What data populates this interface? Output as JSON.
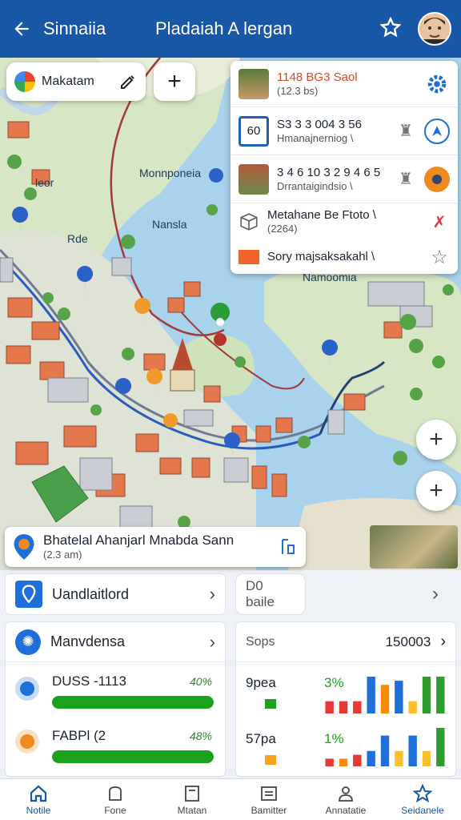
{
  "header": {
    "app_title": "Sinnaiia",
    "page_title": "Pladaiah A lergan"
  },
  "search": {
    "value": "Makatam"
  },
  "info_panel": {
    "rows": [
      {
        "title": "1148 BG3 Saol",
        "subtitle": "(12.3 bs)"
      },
      {
        "title": "S3 3 3 004 3 56",
        "subtitle": "Hmanajnerniog \\",
        "badge": "60"
      },
      {
        "title": "3 4 6 10 3 2 9 4 6 5",
        "subtitle": "Drrantaigindsio \\"
      },
      {
        "title": "Metahane Be Ftoto \\",
        "subtitle": "(2264)"
      },
      {
        "title": "Sory majsaksakahl \\",
        "subtitle": ""
      }
    ]
  },
  "map_labels": {
    "l1": "Monnponeia",
    "l2": "leor",
    "l3": "Nansla",
    "l4": "Rde",
    "l5": "Namoomia"
  },
  "place_card": {
    "name": "Bhatelal Ahanjarl Mnabda Sann",
    "distance": "(2.3 am)"
  },
  "panels": {
    "left_top": "Uandlaitlord",
    "right_top": "D0 baile",
    "left_mid": "Manvdensa",
    "right_mid_label": "Sops",
    "right_mid_value": "150003",
    "stats_left": [
      {
        "label": "DUSS -1113",
        "percent": "40%",
        "fill": 1.0
      },
      {
        "label": "FABPl (2",
        "percent": "48%",
        "fill": 1.0
      }
    ],
    "stats_right": [
      {
        "label": "9pea",
        "percent": "3%"
      },
      {
        "label": "57pa",
        "percent": "1%"
      }
    ]
  },
  "mini_charts": [
    {
      "values": [
        3,
        3,
        3,
        9,
        7,
        8,
        3,
        9,
        9
      ],
      "colors": [
        "#e53935",
        "#e53935",
        "#e53935",
        "#1e6fd9",
        "#fb8c00",
        "#1e6fd9",
        "#fbc02d",
        "#2e9d2e",
        "#2e9d2e"
      ]
    },
    {
      "values": [
        2,
        2,
        3,
        4,
        8,
        4,
        8,
        4,
        10
      ],
      "colors": [
        "#e53935",
        "#fb8c00",
        "#e53935",
        "#1e6fd9",
        "#1e6fd9",
        "#fbc02d",
        "#1e6fd9",
        "#fbc02d",
        "#2e9d2e"
      ]
    }
  ],
  "bottom_nav": [
    {
      "label": "Notile",
      "icon": "home-icon",
      "active": true
    },
    {
      "label": "Fone",
      "icon": "bag-icon",
      "active": false
    },
    {
      "label": "Mtatan",
      "icon": "doc-icon",
      "active": false
    },
    {
      "label": "Bamitter",
      "icon": "board-icon",
      "active": false
    },
    {
      "label": "Annatatie",
      "icon": "person-icon",
      "active": false
    },
    {
      "label": "Seidanele",
      "icon": "star-icon",
      "active": true
    }
  ],
  "colors": {
    "brand": "#1856a6",
    "green": "#1aa31a"
  }
}
